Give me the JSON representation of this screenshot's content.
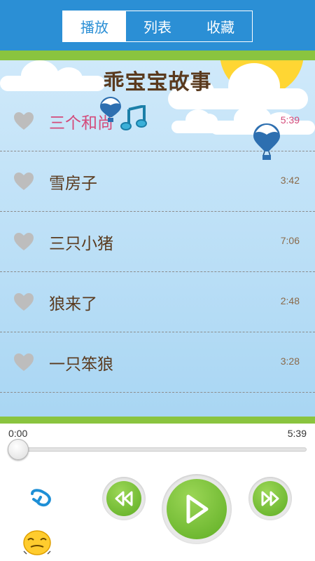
{
  "tabs": [
    {
      "label": "播放",
      "active": true
    },
    {
      "label": "列表",
      "active": false
    },
    {
      "label": "收藏",
      "active": false
    }
  ],
  "title": "乖宝宝故事",
  "songs": [
    {
      "title": "三个和尚",
      "duration": "5:39",
      "playing": true,
      "favorite": false
    },
    {
      "title": "雪房子",
      "duration": "3:42",
      "playing": false,
      "favorite": false
    },
    {
      "title": "三只小猪",
      "duration": "7:06",
      "playing": false,
      "favorite": false
    },
    {
      "title": "狼来了",
      "duration": "2:48",
      "playing": false,
      "favorite": false
    },
    {
      "title": "一只笨狼",
      "duration": "3:28",
      "playing": false,
      "favorite": false
    }
  ],
  "player": {
    "current_time": "0:00",
    "total_time": "5:39",
    "progress": 0
  },
  "icons": {
    "heart": "heart-icon",
    "note": "music-note-icon",
    "prev": "rewind-icon",
    "play": "play-icon",
    "next": "fast-forward-icon",
    "loop": "loop-icon",
    "mood": "sleepy-face-icon"
  },
  "colors": {
    "topbar": "#2b8fd5",
    "green": "#8ac43f",
    "playing": "#d44a7a",
    "text": "#5a3a1e",
    "heart": "#bdbdbd"
  }
}
